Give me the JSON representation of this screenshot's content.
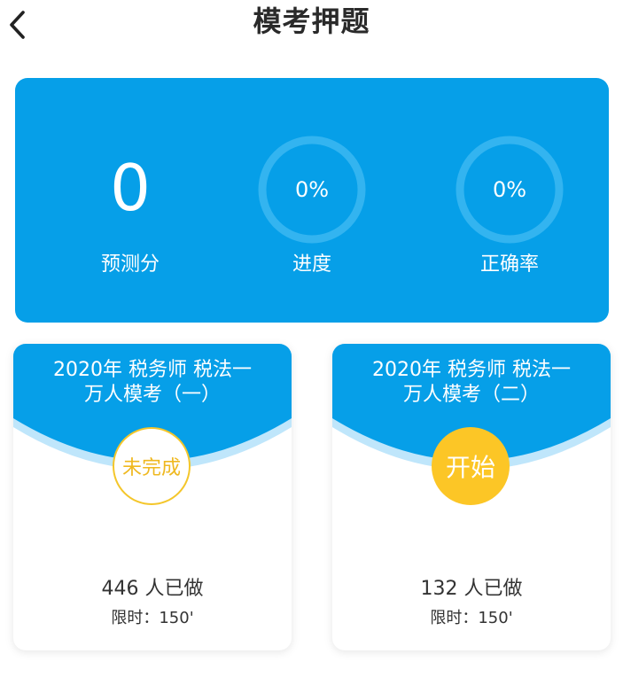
{
  "header": {
    "title": "模考押题"
  },
  "stats": {
    "score_value": "0",
    "score_label": "预测分",
    "progress_value": "0%",
    "progress_label": "进度",
    "accuracy_value": "0%",
    "accuracy_label": "正确率"
  },
  "exams": [
    {
      "title_line1": "2020年 税务师 税法一",
      "title_line2": "万人模考（一）",
      "status": "未完成",
      "done_count": "446 人已做",
      "time_limit": "限时：150'"
    },
    {
      "title_line1": "2020年 税务师 税法一",
      "title_line2": "万人模考（二）",
      "status": "开始",
      "done_count": "132 人已做",
      "time_limit": "限时：150'"
    }
  ],
  "colors": {
    "primary_blue": "#069fe8",
    "arc_light_blue": "#bfe6fb",
    "start_yellow": "#fcc626",
    "incomplete_yellow": "#efb81f",
    "ring_track": "#33b4f0"
  },
  "icons": {
    "back": "chevron-left-icon"
  }
}
